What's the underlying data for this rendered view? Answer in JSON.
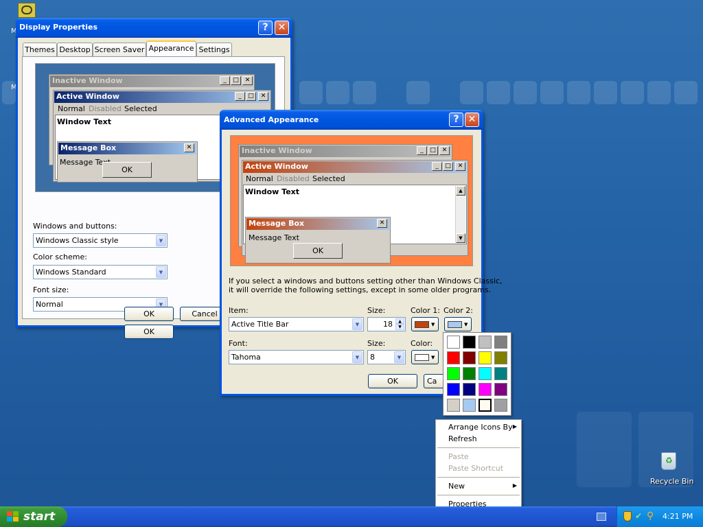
{
  "desktop": {
    "icons": [
      {
        "label": "M",
        "name": "my-computer"
      },
      {
        "label": "Recycle Bin",
        "name": "recycle-bin"
      }
    ]
  },
  "display_properties": {
    "title": "Display Properties",
    "help_btn": "?",
    "close_btn": "✕",
    "tabs": [
      "Themes",
      "Desktop",
      "Screen Saver",
      "Appearance",
      "Settings"
    ],
    "selected_tab": "Appearance",
    "preview": {
      "inactive_title": "Inactive Window",
      "active_title": "Active Window",
      "menu": [
        "Normal",
        "Disabled",
        "Selected"
      ],
      "window_text": "Window Text",
      "message_box_title": "Message Box",
      "message_text": "Message Text",
      "ok": "OK"
    },
    "windows_buttons_label": "Windows and buttons:",
    "windows_buttons_value": "Windows Classic style",
    "color_scheme_label": "Color scheme:",
    "color_scheme_value": "Windows Standard",
    "font_size_label": "Font size:",
    "font_size_value": "Normal",
    "ok": "OK",
    "cancel": "Cancel"
  },
  "advanced_appearance": {
    "title": "Advanced Appearance",
    "help_btn": "?",
    "close_btn": "✕",
    "preview": {
      "inactive_title": "Inactive Window",
      "active_title": "Active Window",
      "menu": [
        "Normal",
        "Disabled",
        "Selected"
      ],
      "window_text": "Window Text",
      "message_box_title": "Message Box",
      "message_text": "Message Text",
      "ok": "OK"
    },
    "info_line1": "If you select a windows and buttons setting other than Windows Classic,",
    "info_line2": "it will override the following settings, except in some older programs.",
    "item_label": "Item:",
    "item_value": "Active Title Bar",
    "size_label": "Size:",
    "size_value": "18",
    "color1_label": "Color 1:",
    "color1_value": "#c1440e",
    "color2_label": "Color 2:",
    "color2_value": "#a6caf0",
    "font_label": "Font:",
    "font_value": "Tahoma",
    "font_size_label": "Size:",
    "font_size_value": "8",
    "font_color_label": "Color:",
    "font_color_value": "#ffffff",
    "ok": "OK",
    "cancel": "Ca"
  },
  "color_palette": {
    "colors": [
      "#ffffff",
      "#000000",
      "#c0c0c0",
      "#808080",
      "#ff0000",
      "#800000",
      "#ffff00",
      "#808000",
      "#00ff00",
      "#008000",
      "#00ffff",
      "#008080",
      "#0000ff",
      "#000080",
      "#ff00ff",
      "#800080",
      "#d4d0c8",
      "#a6caf0",
      "#fffbf0",
      "#a0a0a4"
    ],
    "selected_index": 18
  },
  "context_menu": {
    "items": [
      {
        "label": "Arrange Icons By",
        "submenu": true,
        "disabled": false
      },
      {
        "label": "Refresh",
        "submenu": false,
        "disabled": false
      },
      {
        "label": "Paste",
        "submenu": false,
        "disabled": true
      },
      {
        "label": "Paste Shortcut",
        "submenu": false,
        "disabled": true
      },
      {
        "label": "New",
        "submenu": true,
        "disabled": false
      },
      {
        "label": "Properties",
        "submenu": false,
        "disabled": false
      }
    ]
  },
  "taskbar": {
    "start_label": "start",
    "clock": "4:21 PM"
  },
  "colors": {
    "desktop": "#2462a6",
    "xp_blue_title": "#0054e3",
    "dialog_face": "#ece9d8",
    "preview_bg_blue": "#3a6ea5",
    "preview_bg_orange": "#ff8040"
  }
}
